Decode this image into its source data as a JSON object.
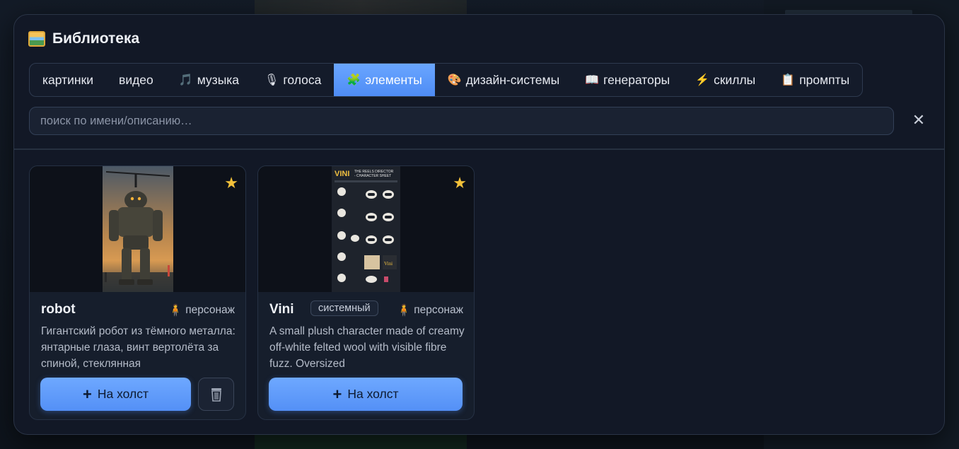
{
  "window": {
    "title": "Библиотека",
    "icon": "picture-frame-icon"
  },
  "tabs": [
    {
      "label": "картинки",
      "icon": ""
    },
    {
      "label": "видео",
      "icon": ""
    },
    {
      "label": "музыка",
      "icon": "music-note-icon",
      "glyph": "🎵"
    },
    {
      "label": "голоса",
      "icon": "microphone-icon",
      "glyph": "🎙"
    },
    {
      "label": "элементы",
      "icon": "puzzle-icon",
      "glyph": "🧩",
      "active": true
    },
    {
      "label": "дизайн-системы",
      "icon": "palette-icon",
      "glyph": "🎨"
    },
    {
      "label": "генераторы",
      "icon": "open-book-icon",
      "glyph": "📖"
    },
    {
      "label": "скиллы",
      "icon": "lightning-icon",
      "glyph": "⚡"
    },
    {
      "label": "промпты",
      "icon": "clipboard-icon",
      "glyph": "📋"
    }
  ],
  "search": {
    "placeholder": "поиск по имени/описанию…",
    "value": "",
    "clear_icon": "close-icon",
    "clear_glyph": "✕"
  },
  "cards": [
    {
      "name": "robot",
      "kind": "персонаж",
      "kind_icon": "person-icon",
      "favorite": true,
      "badge": "",
      "description": "Гигантский робот из тёмного металла: янтарные глаза, винт вертолёта за спиной, стеклянная",
      "add_label": "На холст",
      "has_delete": true
    },
    {
      "name": "Vini",
      "kind": "персонаж",
      "kind_icon": "person-icon",
      "favorite": true,
      "badge": "системный",
      "description": "A small plush character made of creamy off-white felted wool with visible fibre fuzz. Oversized",
      "add_label": "На холст",
      "has_delete": false,
      "thumb_title": "VINI THE REELS DIRECTOR - CHARACTER SHEET"
    }
  ],
  "colors": {
    "accent": "#5a96f8",
    "star": "#f3c13a",
    "background": "#121826"
  }
}
